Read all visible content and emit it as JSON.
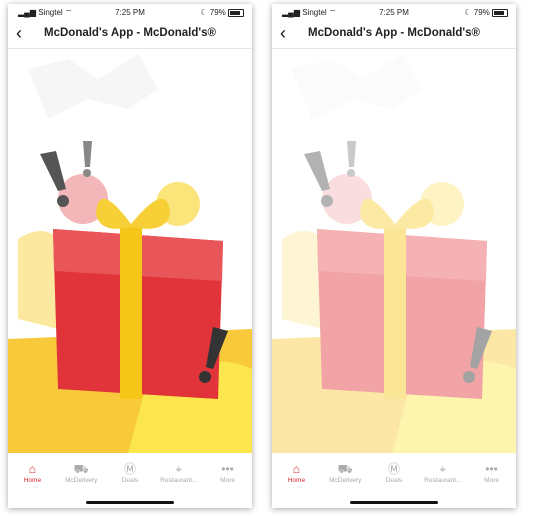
{
  "status": {
    "carrier": "Singtel",
    "time": "7:25 PM",
    "battery": "79%"
  },
  "nav": {
    "back": "‹",
    "title": "McDonald's App - McDonald's®"
  },
  "tabs": [
    {
      "label": "Home",
      "icon": "home-icon",
      "glyph": "⌂"
    },
    {
      "label": "McDelivery",
      "icon": "scooter-icon",
      "glyph": "⛟"
    },
    {
      "label": "Deals",
      "icon": "deals-icon",
      "glyph": "Ⓜ"
    },
    {
      "label": "Restaurant...",
      "icon": "location-pin-icon",
      "glyph": "⌖"
    },
    {
      "label": "More",
      "icon": "more-icon",
      "glyph": "•••"
    }
  ],
  "colors": {
    "accent": "#d4272c",
    "yellow": "#f5c518",
    "gift_red": "#e0343a"
  }
}
